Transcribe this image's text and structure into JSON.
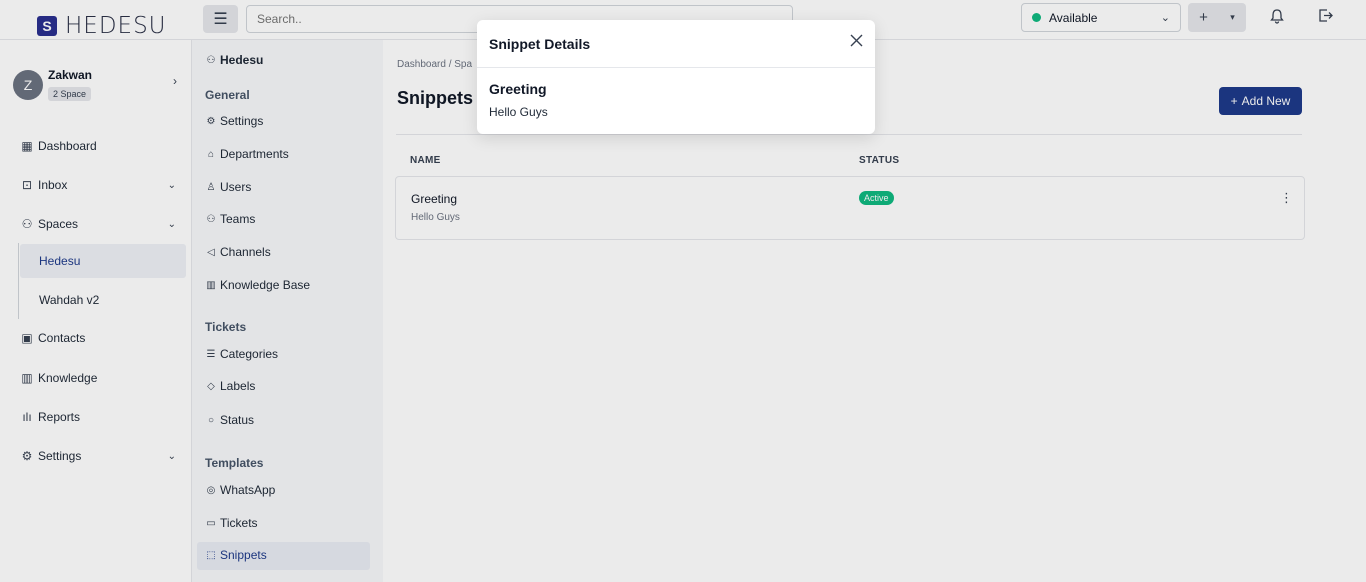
{
  "app": {
    "logo": "HEDESU",
    "logo_mark": "S"
  },
  "topbar": {
    "search_placeholder": "Search..",
    "menu_icon": "hamburger-icon",
    "status_label": "Available",
    "status_color": "#10b981",
    "plus": "+",
    "caret": "▾",
    "bell_icon": "bell-icon",
    "logout_icon": "logout-icon"
  },
  "user": {
    "initial": "Z",
    "name": "Zakwan",
    "badge": "2 Space"
  },
  "sidebar": {
    "items": [
      {
        "label": "Dashboard",
        "icon": "grid-icon"
      },
      {
        "label": "Inbox",
        "icon": "inbox-icon"
      },
      {
        "label": "Spaces",
        "icon": "users-icon"
      },
      {
        "label": "Contacts",
        "icon": "contacts-icon"
      },
      {
        "label": "Knowledge",
        "icon": "book-icon"
      },
      {
        "label": "Reports",
        "icon": "chart-icon"
      },
      {
        "label": "Settings",
        "icon": "gear-icon"
      }
    ],
    "spaces": [
      "Hedesu",
      "Wahdah v2"
    ]
  },
  "sub_sidebar": {
    "title": "Hedesu",
    "sections": {
      "general": "General",
      "tickets": "Tickets",
      "templates": "Templates"
    },
    "general_items": [
      "Settings",
      "Departments",
      "Users",
      "Teams",
      "Channels",
      "Knowledge Base"
    ],
    "ticket_items": [
      "Categories",
      "Labels",
      "Status"
    ],
    "template_items": [
      "WhatsApp",
      "Tickets",
      "Snippets"
    ]
  },
  "main": {
    "breadcrumb": "Dashboard  /  Spa",
    "title": "Snippets",
    "add_button": "Add New",
    "columns": [
      "NAME",
      "STATUS"
    ],
    "rows": [
      {
        "name": "Greeting",
        "content": "Hello Guys",
        "status": "Active"
      }
    ]
  },
  "modal": {
    "title": "Snippet Details",
    "name": "Greeting",
    "content": "Hello Guys"
  },
  "colors": {
    "accent": "#1e3a8a",
    "active": "#10b981"
  }
}
